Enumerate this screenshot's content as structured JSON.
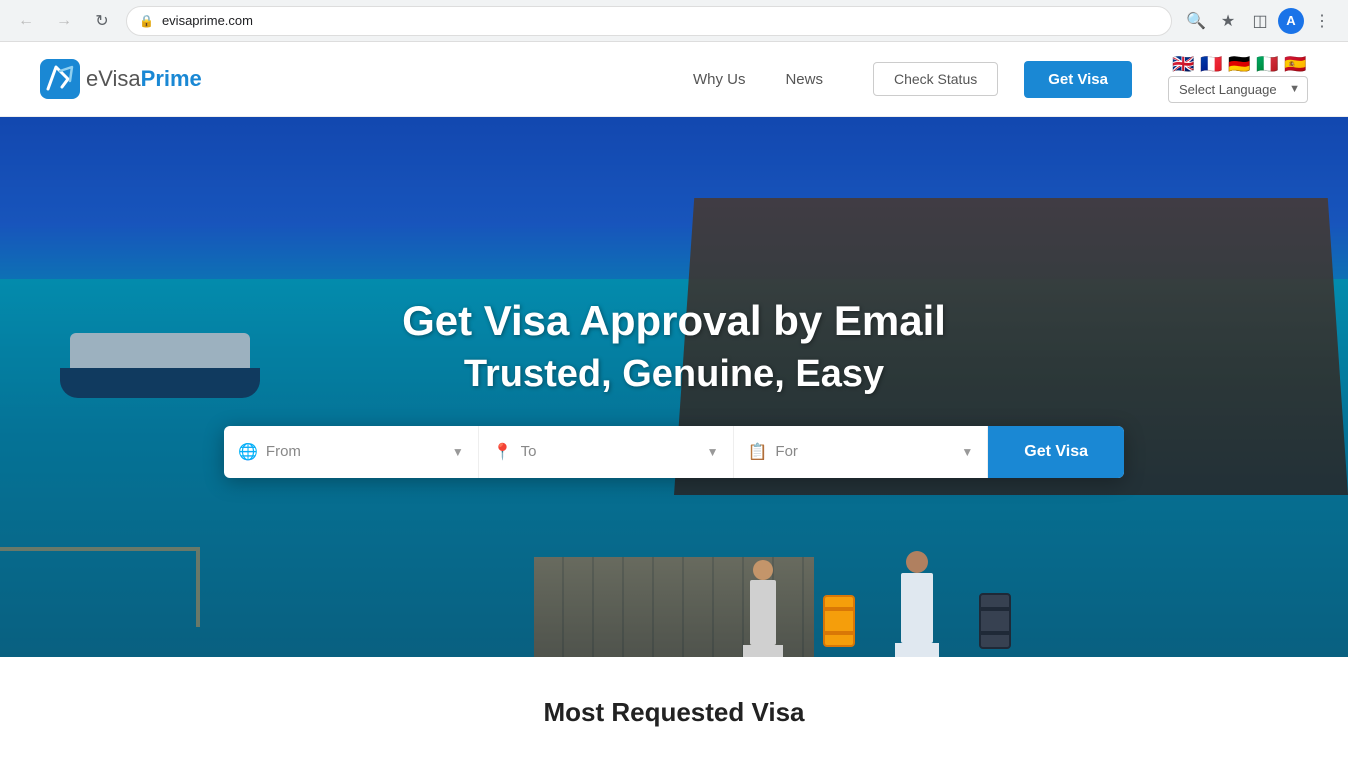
{
  "browser": {
    "url": "evisaprime.com",
    "nav": {
      "back_disabled": true,
      "forward_disabled": true
    },
    "avatar_letter": "A"
  },
  "navbar": {
    "logo_text_evisa": "eVisa",
    "logo_text_prime": "Prime",
    "nav_links": [
      {
        "id": "why-us",
        "label": "Why Us"
      },
      {
        "id": "news",
        "label": "News"
      }
    ],
    "check_status_label": "Check Status",
    "get_visa_label": "Get Visa",
    "language": {
      "select_label": "Select Language",
      "options": [
        "English",
        "French",
        "German",
        "Italian",
        "Spanish"
      ],
      "flags": [
        "🇬🇧",
        "🇫🇷",
        "🇩🇪",
        "🇮🇹",
        "🇪🇸"
      ]
    }
  },
  "hero": {
    "title_line1": "Get Visa Approval by Email",
    "title_line2": "Trusted, Genuine, Easy",
    "search": {
      "from_placeholder": "From",
      "to_placeholder": "To",
      "for_placeholder": "For",
      "get_visa_label": "Get Visa"
    }
  },
  "below_fold": {
    "section_title": "Most Requested Visa"
  }
}
